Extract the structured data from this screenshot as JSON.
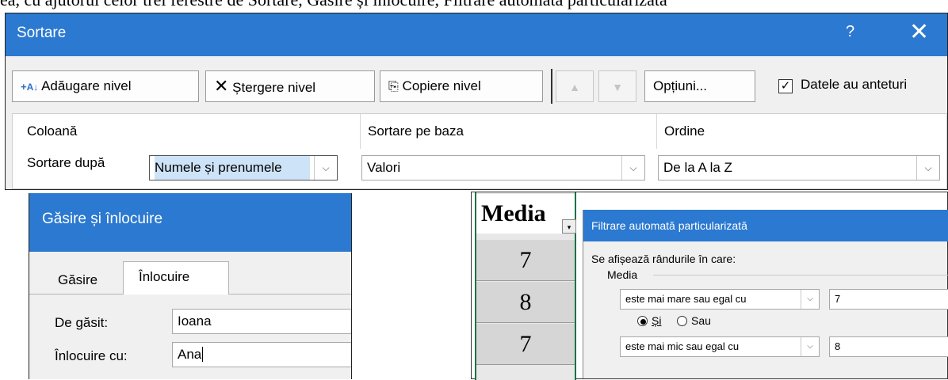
{
  "caption_top": "ea, cu ajutorul celor trei ferestre de Sortare, Găsire și înlocuire, Filtrare automată particularizată",
  "sort_dialog": {
    "title": "Sortare",
    "help_glyph": "?",
    "close_glyph": "✕",
    "buttons": {
      "add_level": "Adăugare nivel",
      "delete_level": "Ștergere nivel",
      "copy_level": "Copiere nivel",
      "options": "Opțiuni..."
    },
    "has_headers_label": "Datele au anteturi",
    "has_headers_checked": true,
    "columns": {
      "col": "Coloană",
      "sort_on": "Sortare pe baza",
      "order": "Ordine"
    },
    "row": {
      "label": "Sortare după",
      "column_value": "Numele și prenumele",
      "sort_on_value": "Valori",
      "order_value": "De la A la Z"
    }
  },
  "find_dialog": {
    "title": "Găsire și înlocuire",
    "tabs": [
      "Găsire",
      "Înlocuire"
    ],
    "active_tab": "Înlocuire",
    "find_label": "De găsit:",
    "find_value": "Ioana",
    "replace_label": "Înlocuire cu:",
    "replace_value": "Ana"
  },
  "filter_area": {
    "sheet_header": "Media",
    "sheet_values": [
      "7",
      "8",
      "7"
    ],
    "dialog_title": "Filtrare automată particularizată",
    "show_rows_label": "Se afișează rândurile în care:",
    "field_name": "Media",
    "cond1_op": "este mai mare sau egal cu",
    "cond1_val": "7",
    "and_label": "Și",
    "or_label": "Sau",
    "and_selected": true,
    "cond2_op": "este mai mic sau egal cu",
    "cond2_val": "8"
  }
}
